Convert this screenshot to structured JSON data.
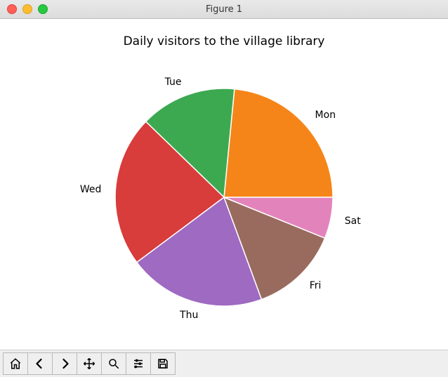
{
  "window": {
    "title": "Figure 1"
  },
  "chart_data": {
    "type": "pie",
    "title": "Daily visitors to the village library",
    "categories": [
      "Mon",
      "Tue",
      "Wed",
      "Thu",
      "Fri",
      "Sat"
    ],
    "values": [
      23,
      14,
      22,
      20,
      13,
      6
    ],
    "colors": [
      "#f58518",
      "#3ca951",
      "#d83c3b",
      "#9e6ac2",
      "#996b5e",
      "#e383bc"
    ],
    "start_angle_deg": 0,
    "direction": "counterclockwise"
  },
  "toolbar": {
    "buttons": [
      {
        "name": "home",
        "tooltip": "Reset original view"
      },
      {
        "name": "back",
        "tooltip": "Back to previous view"
      },
      {
        "name": "forward",
        "tooltip": "Forward to next view"
      },
      {
        "name": "pan",
        "tooltip": "Pan"
      },
      {
        "name": "zoom",
        "tooltip": "Zoom"
      },
      {
        "name": "configure",
        "tooltip": "Configure subplots"
      },
      {
        "name": "save",
        "tooltip": "Save the figure"
      }
    ]
  }
}
